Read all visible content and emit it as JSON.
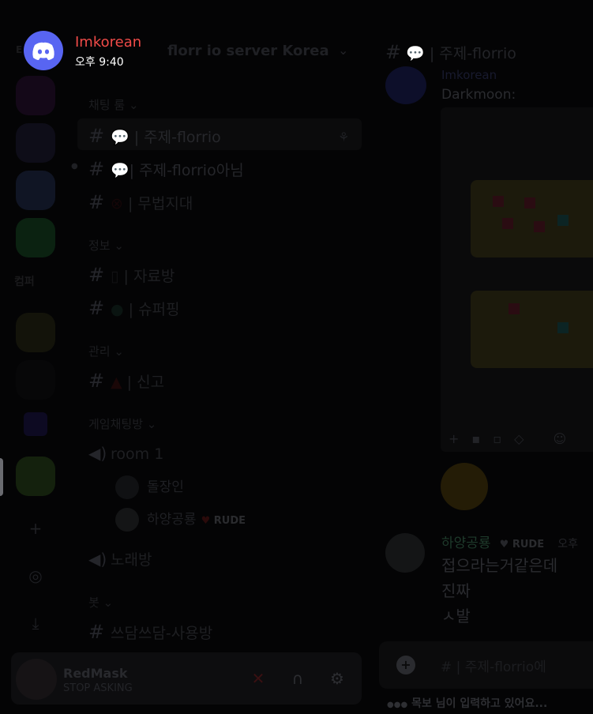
{
  "notification": {
    "title": "Imkorean",
    "time": "오후 9:40",
    "app_icon": "discord-logo-icon",
    "colors": {
      "title": "#f04b48",
      "logo_bg": "#5865f2"
    }
  },
  "rail": {
    "label": "컴퍼",
    "add_server_icon": "plus-icon",
    "discover_icon": "compass-icon",
    "download_icon": "download-icon"
  },
  "server": {
    "name": "florr io server Korea",
    "menu_icon": "chevron-down-icon"
  },
  "categories": {
    "chat": "채팅 룸",
    "info": "정보",
    "admin": "관리",
    "game": "게임채팅방",
    "bot": "봇"
  },
  "channels": {
    "c1": "| 주제-florrio",
    "c2": "| 주제-florrio아님",
    "c3": "| 무법지대",
    "c4": "| 자료방",
    "c5": "| 슈퍼핑",
    "c6": "| 신고",
    "v1": "room 1",
    "v2": "노래방",
    "c7": "쓰담쓰담-사용방"
  },
  "voice_users": {
    "u1": "돌장인",
    "u2": "하양공룡",
    "u2_badge": "RUDE"
  },
  "user_panel": {
    "name": "RedMask",
    "status": "STOP ASKING",
    "mute_icon": "mic-off-icon",
    "headset_icon": "headphones-icon",
    "settings_icon": "gear-icon"
  },
  "main": {
    "header_channel": "| 주제-florrio",
    "msg1_author": "Imkorean",
    "msg1_text": "Darkmoon:",
    "msg2_author": "하양공룡",
    "msg2_badge": "RUDE",
    "msg2_time": "오후",
    "msg2_lines": [
      "접으라는거같은데",
      "진짜",
      "ㅅ발"
    ],
    "composer_placeholder": "# | 주제-florrio에",
    "typing": "목보 님이 입력하고 있어요..."
  }
}
